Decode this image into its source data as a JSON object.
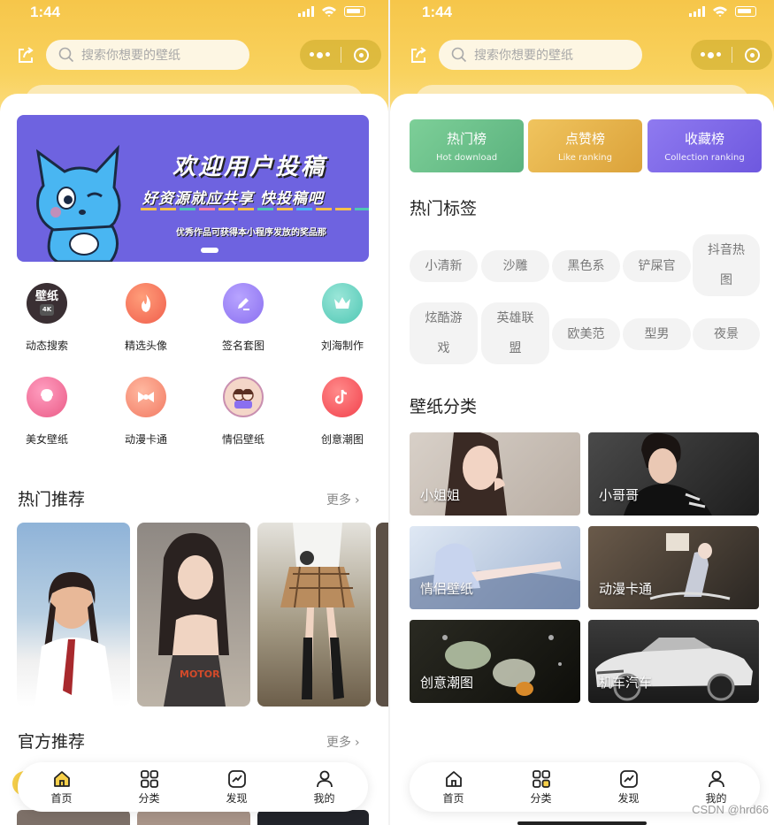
{
  "status": {
    "time": "1:44"
  },
  "search": {
    "placeholder": "搜索你想要的壁纸"
  },
  "banner": {
    "title": "欢迎用户投稿",
    "subtitle": "好资源就应共享  快投稿吧",
    "note": "优秀作品可获得本小程序发放的奖品那"
  },
  "home_grid": [
    {
      "label": "动态搜索",
      "icon": "wallpaper-4k-icon",
      "badge": "壁纸",
      "color": "#3a2f33"
    },
    {
      "label": "精选头像",
      "icon": "flame-icon",
      "color": "#f05e4c"
    },
    {
      "label": "签名套图",
      "icon": "pen-icon",
      "color": "#8a6ff0"
    },
    {
      "label": "刘海制作",
      "icon": "crown-icon",
      "color": "#4fc7b4"
    },
    {
      "label": "美女壁纸",
      "icon": "girl-icon",
      "color": "#ea5a86"
    },
    {
      "label": "动漫卡通",
      "icon": "bow-icon",
      "color": "#f27a63"
    },
    {
      "label": "情侣壁纸",
      "icon": "couple-icon",
      "color": "#a86bb5"
    },
    {
      "label": "创意潮图",
      "icon": "tiktok-icon",
      "color": "#f2414c"
    }
  ],
  "hot": {
    "title": "热门推荐",
    "more": "更多"
  },
  "official": {
    "title": "官方推荐",
    "more": "更多"
  },
  "tabs": [
    {
      "label": "首页",
      "icon": "home-icon"
    },
    {
      "label": "分类",
      "icon": "grid-icon"
    },
    {
      "label": "发现",
      "icon": "trend-icon"
    },
    {
      "label": "我的",
      "icon": "user-icon"
    }
  ],
  "rankings": [
    {
      "title": "热门榜",
      "subtitle": "Hot download",
      "color": "#6cc18d"
    },
    {
      "title": "点赞榜",
      "subtitle": "Like ranking",
      "color": "#e8b24a"
    },
    {
      "title": "收藏榜",
      "subtitle": "Collection ranking",
      "color": "#7f69e8"
    }
  ],
  "tags_section": {
    "title": "热门标签"
  },
  "tags": [
    "小清新",
    "沙雕",
    "黑色系",
    "铲屎官",
    "抖音热图",
    "炫酷游戏",
    "英雄联盟",
    "欧美范",
    "型男",
    "夜景"
  ],
  "categories_section": {
    "title": "壁纸分类"
  },
  "categories": [
    {
      "label": "小姐姐"
    },
    {
      "label": "小哥哥"
    },
    {
      "label": "情侣壁纸"
    },
    {
      "label": "动漫卡通"
    },
    {
      "label": "创意潮图"
    },
    {
      "label": "机车汽车"
    }
  ],
  "watermark": "CSDN @hrd66"
}
